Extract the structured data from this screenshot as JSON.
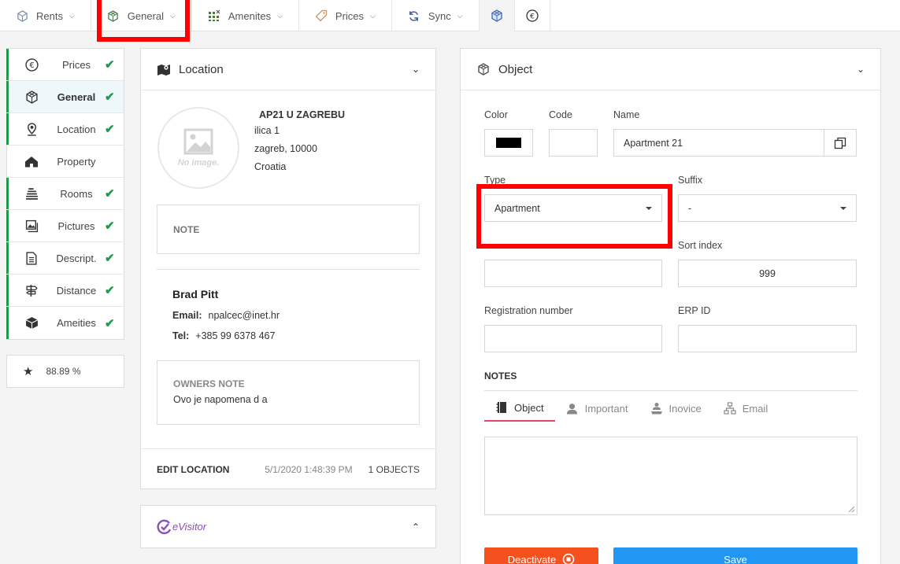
{
  "topnav": {
    "tabs": [
      {
        "label": "Rents",
        "icon": "cube-outline-icon"
      },
      {
        "label": "General",
        "icon": "cube-green-icon"
      },
      {
        "label": "Amenites",
        "icon": "grid-icon"
      },
      {
        "label": "Prices",
        "icon": "price-tag-icon"
      },
      {
        "label": "Sync",
        "icon": "sync-icon"
      }
    ],
    "icon_tabs": [
      "cube-blue-icon",
      "euro-icon"
    ]
  },
  "sidebar": {
    "items": [
      {
        "label": "Prices",
        "icon": "euro-icon",
        "done": true
      },
      {
        "label": "General",
        "icon": "cube-icon",
        "done": true,
        "active": true
      },
      {
        "label": "Location",
        "icon": "map-pin-icon",
        "done": true
      },
      {
        "label": "Property",
        "icon": "house-icon",
        "done": false
      },
      {
        "label": "Rooms",
        "icon": "bed-icon",
        "done": true
      },
      {
        "label": "Pictures",
        "icon": "pictures-icon",
        "done": true
      },
      {
        "label": "Descript.",
        "icon": "document-icon",
        "done": true
      },
      {
        "label": "Distance",
        "icon": "signpost-icon",
        "done": true
      },
      {
        "label": "Ameities",
        "icon": "box-icon",
        "done": true
      }
    ],
    "score": "88.89 %"
  },
  "location": {
    "title": "Location",
    "no_image": "No image.",
    "name": "AP21 U ZAGREBU",
    "street": "ilica 1",
    "city": "zagreb, 10000",
    "country": "Croatia",
    "note_label": "NOTE",
    "owner_name": "Brad Pitt",
    "email_label": "Email:",
    "email": "npalcec@inet.hr",
    "tel_label": "Tel:",
    "tel": "+385 99 6378 467",
    "owners_note_label": "OWNERS NOTE",
    "owners_note": "Ovo je napomena d a",
    "edit_label": "EDIT LOCATION",
    "timestamp": "5/1/2020 1:48:39 PM",
    "objects": "1 OBJECTS"
  },
  "evisitor": {
    "label": "eVisitor"
  },
  "object": {
    "title": "Object",
    "color_label": "Color",
    "color_value": "#000000",
    "code_label": "Code",
    "code_value": "",
    "name_label": "Name",
    "name_value": "Apartment 21",
    "type_label": "Type",
    "type_value": "Apartment",
    "suffix_label": "Suffix",
    "suffix_value": "-",
    "sort_label": "Sort index",
    "sort_value": "999",
    "reg_label": "Registration number",
    "reg_value": "",
    "erp_label": "ERP ID",
    "erp_value": "",
    "notes_label": "NOTES",
    "note_tabs": [
      {
        "label": "Object",
        "icon": "notebook-icon"
      },
      {
        "label": "Important",
        "icon": "user-icon"
      },
      {
        "label": "Inovice",
        "icon": "cleaner-icon"
      },
      {
        "label": "Email",
        "icon": "sitemap-icon"
      }
    ],
    "deactivate_label": "Deactivate",
    "save_label": "Save"
  }
}
